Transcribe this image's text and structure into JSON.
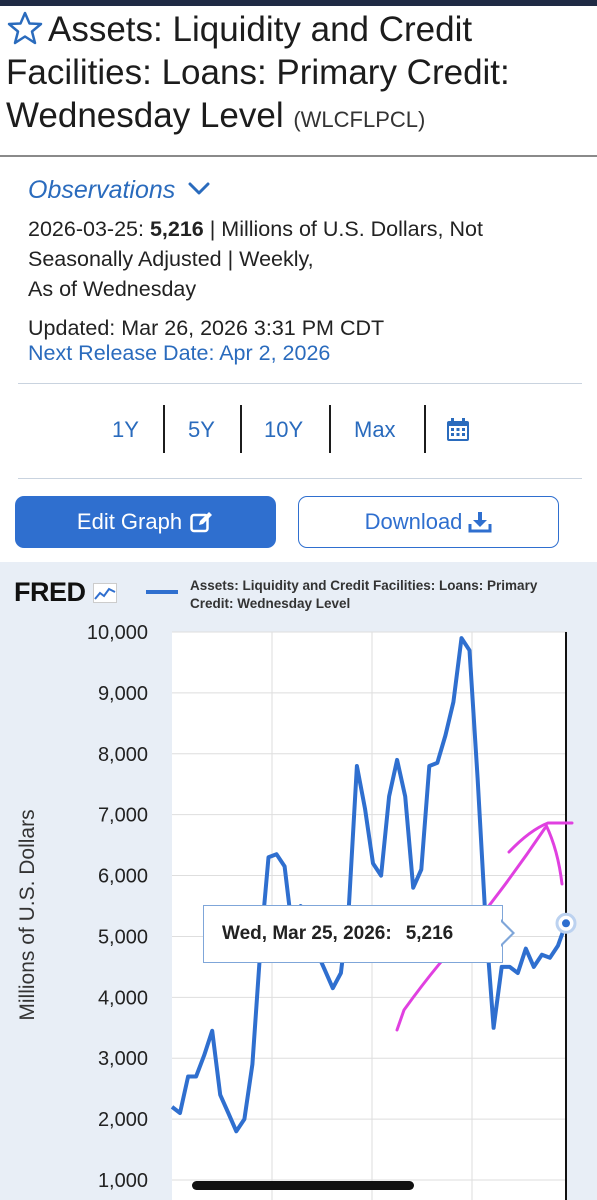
{
  "series_title": "Assets: Liquidity and Credit Facilities: Loans: Primary Credit: Wednesday Level",
  "series_code": "(WLCFLPCL)",
  "observations": {
    "heading": "Observations",
    "date": "2026-03-25:",
    "value": "5,216",
    "units_text": "| Millions of U.S. Dollars, Not Seasonally Adjusted | Weekly,",
    "frequency_note": "As of Wednesday",
    "updated": "Updated: Mar 26, 2026 3:31 PM CDT",
    "next_release": "Next Release Date: Apr 2, 2026"
  },
  "ranges": [
    "1Y",
    "5Y",
    "10Y",
    "Max"
  ],
  "buttons": {
    "edit": "Edit Graph",
    "download": "Download"
  },
  "icons": [
    "star-icon",
    "chevron-down-icon",
    "calendar-icon",
    "edit-icon",
    "download-icon",
    "fred-chart-icon"
  ],
  "colors": {
    "accent": "#2f6fcf",
    "link": "#2a6bbd",
    "series": "#2f6fcf",
    "annotation": "#e040e0",
    "chart_bg": "#e8eef6"
  },
  "chart": {
    "logo": "FRED",
    "legend": "Assets: Liquidity and Credit Facilities: Loans: Primary Credit: Wednesday Level",
    "tooltip": {
      "date": "Wed, Mar 25, 2026:",
      "value": "5,216"
    }
  },
  "chart_data": {
    "type": "line",
    "title": "",
    "xlabel": "",
    "ylabel": "Millions of U.S. Dollars",
    "ylim": [
      1000,
      10000
    ],
    "yticks": [
      "10,000",
      "9,000",
      "8,000",
      "7,000",
      "6,000",
      "5,000",
      "4,000",
      "3,000",
      "2,000",
      "1,000"
    ],
    "grid": true,
    "legend_position": "top",
    "series": [
      {
        "name": "Assets: Liquidity and Credit Facilities: Loans: Primary Credit: Wednesday Level",
        "values": [
          2200,
          2100,
          2700,
          2700,
          3050,
          3450,
          2400,
          2100,
          1800,
          2000,
          2900,
          4800,
          6300,
          6350,
          6150,
          5050,
          5500,
          5100,
          4750,
          4450,
          4150,
          4400,
          5500,
          7800,
          7100,
          6200,
          6000,
          7300,
          7900,
          7300,
          5800,
          6100,
          7800,
          7850,
          8300,
          8850,
          9900,
          9700,
          7600,
          5250,
          3500,
          4500,
          4500,
          4400,
          4800,
          4500,
          4700,
          4650,
          4850,
          5216
        ]
      }
    ],
    "annotation": "hand-drawn magenta upward arrow"
  }
}
